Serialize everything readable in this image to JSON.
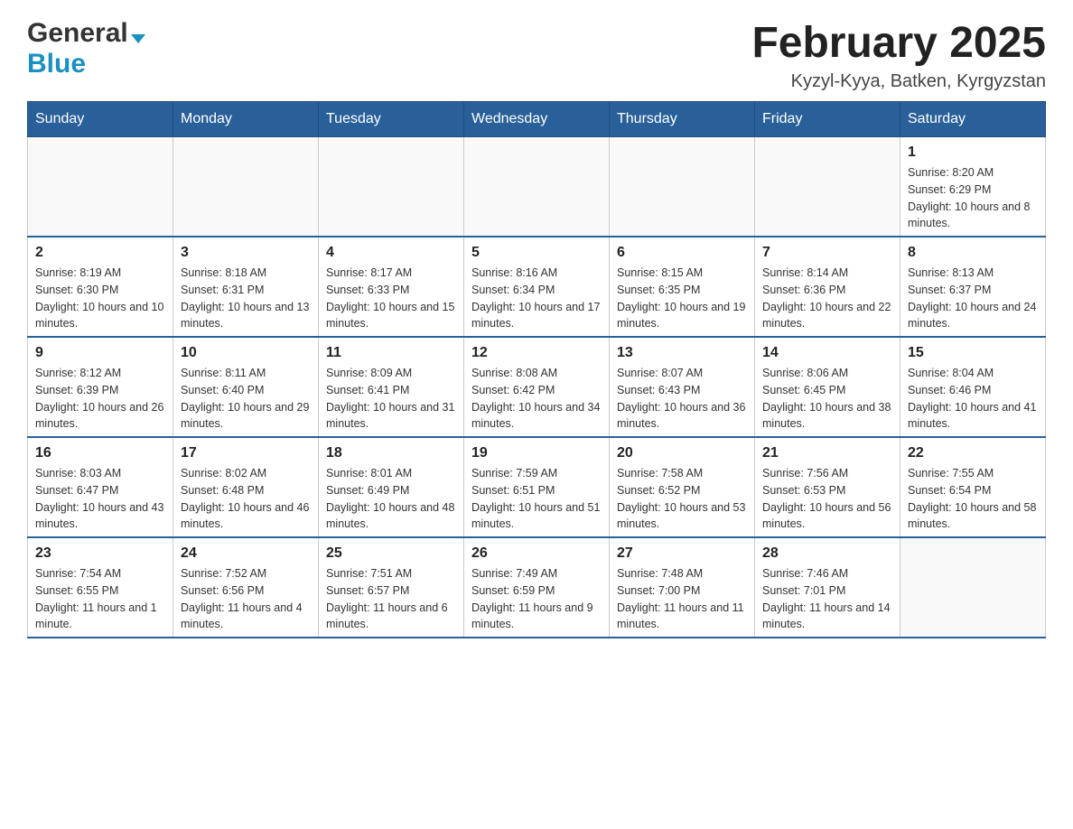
{
  "header": {
    "logo_general": "General",
    "logo_blue": "Blue",
    "month_title": "February 2025",
    "location": "Kyzyl-Kyya, Batken, Kyrgyzstan"
  },
  "days_of_week": [
    "Sunday",
    "Monday",
    "Tuesday",
    "Wednesday",
    "Thursday",
    "Friday",
    "Saturday"
  ],
  "weeks": [
    [
      {
        "day": "",
        "info": ""
      },
      {
        "day": "",
        "info": ""
      },
      {
        "day": "",
        "info": ""
      },
      {
        "day": "",
        "info": ""
      },
      {
        "day": "",
        "info": ""
      },
      {
        "day": "",
        "info": ""
      },
      {
        "day": "1",
        "info": "Sunrise: 8:20 AM\nSunset: 6:29 PM\nDaylight: 10 hours and 8 minutes."
      }
    ],
    [
      {
        "day": "2",
        "info": "Sunrise: 8:19 AM\nSunset: 6:30 PM\nDaylight: 10 hours and 10 minutes."
      },
      {
        "day": "3",
        "info": "Sunrise: 8:18 AM\nSunset: 6:31 PM\nDaylight: 10 hours and 13 minutes."
      },
      {
        "day": "4",
        "info": "Sunrise: 8:17 AM\nSunset: 6:33 PM\nDaylight: 10 hours and 15 minutes."
      },
      {
        "day": "5",
        "info": "Sunrise: 8:16 AM\nSunset: 6:34 PM\nDaylight: 10 hours and 17 minutes."
      },
      {
        "day": "6",
        "info": "Sunrise: 8:15 AM\nSunset: 6:35 PM\nDaylight: 10 hours and 19 minutes."
      },
      {
        "day": "7",
        "info": "Sunrise: 8:14 AM\nSunset: 6:36 PM\nDaylight: 10 hours and 22 minutes."
      },
      {
        "day": "8",
        "info": "Sunrise: 8:13 AM\nSunset: 6:37 PM\nDaylight: 10 hours and 24 minutes."
      }
    ],
    [
      {
        "day": "9",
        "info": "Sunrise: 8:12 AM\nSunset: 6:39 PM\nDaylight: 10 hours and 26 minutes."
      },
      {
        "day": "10",
        "info": "Sunrise: 8:11 AM\nSunset: 6:40 PM\nDaylight: 10 hours and 29 minutes."
      },
      {
        "day": "11",
        "info": "Sunrise: 8:09 AM\nSunset: 6:41 PM\nDaylight: 10 hours and 31 minutes."
      },
      {
        "day": "12",
        "info": "Sunrise: 8:08 AM\nSunset: 6:42 PM\nDaylight: 10 hours and 34 minutes."
      },
      {
        "day": "13",
        "info": "Sunrise: 8:07 AM\nSunset: 6:43 PM\nDaylight: 10 hours and 36 minutes."
      },
      {
        "day": "14",
        "info": "Sunrise: 8:06 AM\nSunset: 6:45 PM\nDaylight: 10 hours and 38 minutes."
      },
      {
        "day": "15",
        "info": "Sunrise: 8:04 AM\nSunset: 6:46 PM\nDaylight: 10 hours and 41 minutes."
      }
    ],
    [
      {
        "day": "16",
        "info": "Sunrise: 8:03 AM\nSunset: 6:47 PM\nDaylight: 10 hours and 43 minutes."
      },
      {
        "day": "17",
        "info": "Sunrise: 8:02 AM\nSunset: 6:48 PM\nDaylight: 10 hours and 46 minutes."
      },
      {
        "day": "18",
        "info": "Sunrise: 8:01 AM\nSunset: 6:49 PM\nDaylight: 10 hours and 48 minutes."
      },
      {
        "day": "19",
        "info": "Sunrise: 7:59 AM\nSunset: 6:51 PM\nDaylight: 10 hours and 51 minutes."
      },
      {
        "day": "20",
        "info": "Sunrise: 7:58 AM\nSunset: 6:52 PM\nDaylight: 10 hours and 53 minutes."
      },
      {
        "day": "21",
        "info": "Sunrise: 7:56 AM\nSunset: 6:53 PM\nDaylight: 10 hours and 56 minutes."
      },
      {
        "day": "22",
        "info": "Sunrise: 7:55 AM\nSunset: 6:54 PM\nDaylight: 10 hours and 58 minutes."
      }
    ],
    [
      {
        "day": "23",
        "info": "Sunrise: 7:54 AM\nSunset: 6:55 PM\nDaylight: 11 hours and 1 minute."
      },
      {
        "day": "24",
        "info": "Sunrise: 7:52 AM\nSunset: 6:56 PM\nDaylight: 11 hours and 4 minutes."
      },
      {
        "day": "25",
        "info": "Sunrise: 7:51 AM\nSunset: 6:57 PM\nDaylight: 11 hours and 6 minutes."
      },
      {
        "day": "26",
        "info": "Sunrise: 7:49 AM\nSunset: 6:59 PM\nDaylight: 11 hours and 9 minutes."
      },
      {
        "day": "27",
        "info": "Sunrise: 7:48 AM\nSunset: 7:00 PM\nDaylight: 11 hours and 11 minutes."
      },
      {
        "day": "28",
        "info": "Sunrise: 7:46 AM\nSunset: 7:01 PM\nDaylight: 11 hours and 14 minutes."
      },
      {
        "day": "",
        "info": ""
      }
    ]
  ]
}
